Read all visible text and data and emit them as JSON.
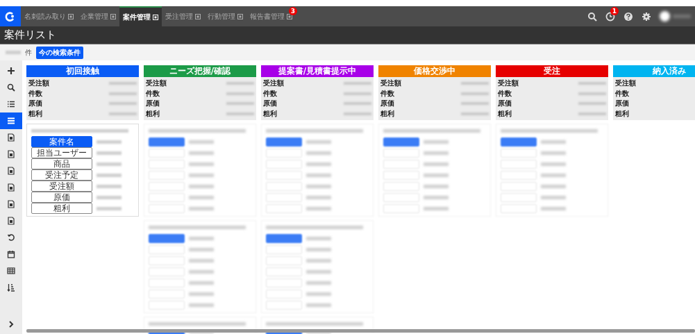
{
  "nav_tabs": [
    {
      "label": "名刺読み取り",
      "selected": false
    },
    {
      "label": "企業管理",
      "selected": false
    },
    {
      "label": "案件管理",
      "selected": true
    },
    {
      "label": "受注管理",
      "selected": false
    },
    {
      "label": "行動管理",
      "selected": false
    },
    {
      "label": "報告書管理",
      "selected": false,
      "badge": "3"
    }
  ],
  "header_icons": [
    {
      "kind": "search"
    },
    {
      "kind": "clock",
      "badge": "1"
    },
    {
      "kind": "help"
    },
    {
      "kind": "settings"
    }
  ],
  "page_title": "案件リスト",
  "toolbar": {
    "count_unit": "件",
    "filter_button": "今の検索条件"
  },
  "sidebar": [
    {
      "kind": "plus",
      "selected": false
    },
    {
      "kind": "search",
      "selected": false
    },
    {
      "kind": "list",
      "selected": false
    },
    {
      "kind": "rows",
      "selected": true
    },
    {
      "kind": "doc",
      "selected": false
    },
    {
      "kind": "doc",
      "selected": false
    },
    {
      "kind": "doc",
      "selected": false
    },
    {
      "kind": "doc",
      "selected": false
    },
    {
      "kind": "doc",
      "selected": false
    },
    {
      "kind": "doc",
      "selected": false
    },
    {
      "kind": "history",
      "selected": false
    },
    {
      "kind": "calendar",
      "selected": false
    },
    {
      "kind": "table",
      "selected": false
    },
    {
      "kind": "sort",
      "selected": false
    },
    {
      "kind": "chevron",
      "selected": false
    }
  ],
  "columns": [
    {
      "title": "初回接触",
      "color": "#0a5cf5",
      "stats": [
        "受注額",
        "件数",
        "原価",
        "粗利"
      ],
      "cards": [
        {
          "kind": "fields",
          "fields": [
            {
              "label": "案件名",
              "selected": true
            },
            {
              "label": "担当ユーザー",
              "selected": false
            },
            {
              "label": "商品",
              "selected": false
            },
            {
              "label": "受注予定",
              "selected": false
            },
            {
              "label": "受注額",
              "selected": false
            },
            {
              "label": "原価",
              "selected": false
            },
            {
              "label": "粗利",
              "selected": false
            }
          ]
        }
      ]
    },
    {
      "title": "ニーズ把握/確認",
      "color": "#1c9b48",
      "stats": [
        "受注額",
        "件数",
        "原価",
        "粗利"
      ],
      "cards": [
        {
          "kind": "blurred"
        },
        {
          "kind": "blurred"
        },
        {
          "kind": "blurred"
        }
      ]
    },
    {
      "title": "提案書/見積書提示中",
      "color": "#a800e8",
      "stats": [
        "受注額",
        "件数",
        "原価",
        "粗利"
      ],
      "cards": [
        {
          "kind": "blurred"
        },
        {
          "kind": "blurred"
        },
        {
          "kind": "blurred"
        }
      ]
    },
    {
      "title": "価格交渉中",
      "color": "#f08300",
      "stats": [
        "受注額",
        "件数",
        "原価",
        "粗利"
      ],
      "cards": [
        {
          "kind": "blurred"
        }
      ]
    },
    {
      "title": "受注",
      "color": "#e60000",
      "stats": [
        "受注額",
        "件数",
        "原価",
        "粗利"
      ],
      "cards": [
        {
          "kind": "blurred"
        }
      ]
    },
    {
      "title": "納入済み",
      "color": "#00b4f0",
      "stats": [
        "受注額",
        "件数",
        "原価",
        "粗利"
      ]
    }
  ]
}
